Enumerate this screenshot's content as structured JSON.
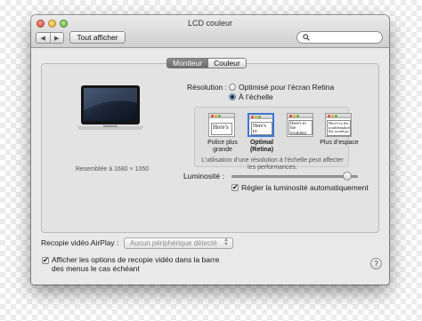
{
  "window": {
    "title": "LCD couleur"
  },
  "toolbar": {
    "back_glyph": "◀",
    "forward_glyph": "▶",
    "show_all_label": "Tout afficher",
    "search_placeholder": ""
  },
  "tabs": [
    {
      "label": "Moniteur",
      "active": true
    },
    {
      "label": "Couleur",
      "active": false
    }
  ],
  "display": {
    "resolution_caption": "Resemblée à 1680 × 1050"
  },
  "resolution": {
    "label": "Résolution :",
    "options": [
      {
        "label": "Optimisé pour l’écran Retina",
        "selected": false
      },
      {
        "label": "À l’échelle",
        "selected": true
      }
    ]
  },
  "scaled_options": [
    {
      "preview_text": "Here's",
      "caption": "Police plus grande",
      "selected": false
    },
    {
      "preview_text": "Here's to troublem",
      "caption": "Optimal (Retina)",
      "selected": true
    },
    {
      "preview_text": "Here's to the troublem ones who",
      "caption": "",
      "selected": false
    },
    {
      "preview_text": "Here's to the troublemakers the round pe",
      "caption": "Plus d’espace",
      "selected": false
    }
  ],
  "scaled_note": "L’utilisation d’une résolution à l’échelle peut affecter les performances.",
  "brightness": {
    "label": "Luminosité :",
    "level_fraction": 0.95,
    "auto_label": "Régler la luminosité automatiquement",
    "auto_checked": true
  },
  "airplay": {
    "label": "Recopie vidéo AirPlay :",
    "value": "Aucun périphérique détecté"
  },
  "mirroring_option": {
    "line1": "Afficher les options de recopie vidéo dans la barre",
    "line2": "des menus le cas échéant",
    "checked": true
  },
  "help_glyph": "?",
  "check_glyph": "✔",
  "colors": {
    "close": "#d9483b",
    "minimize": "#e2a72b",
    "maximize": "#5fb33c",
    "selection": "#3b77d3"
  }
}
